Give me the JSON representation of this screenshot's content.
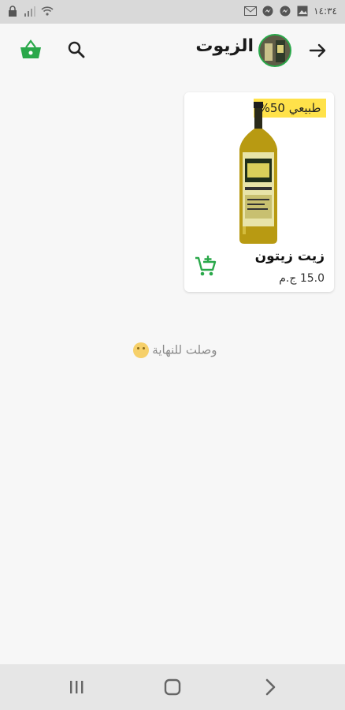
{
  "status_bar": {
    "time": "١٤:٣٤",
    "icons": [
      "sim-lock-icon",
      "signal-icon",
      "wifi-icon",
      "gmail-icon",
      "messenger-icon",
      "messenger-icon",
      "image-icon"
    ]
  },
  "app_bar": {
    "title": "الزيوت",
    "back_icon": "arrow-right-icon",
    "search_icon": "search-icon",
    "basket_icon": "basket-icon"
  },
  "products": [
    {
      "name": "زيت زيتون",
      "price": "15.0 ج.م",
      "badge": "طبيعي 50%"
    }
  ],
  "end_message": "وصلت للنهاية",
  "nav_bar": {
    "recent_icon": "recent-apps-icon",
    "home_icon": "home-icon",
    "back_icon": "nav-back-icon"
  },
  "colors": {
    "accent": "#2aa84a",
    "badge": "#ffe24a",
    "background": "#f7f7f7"
  }
}
